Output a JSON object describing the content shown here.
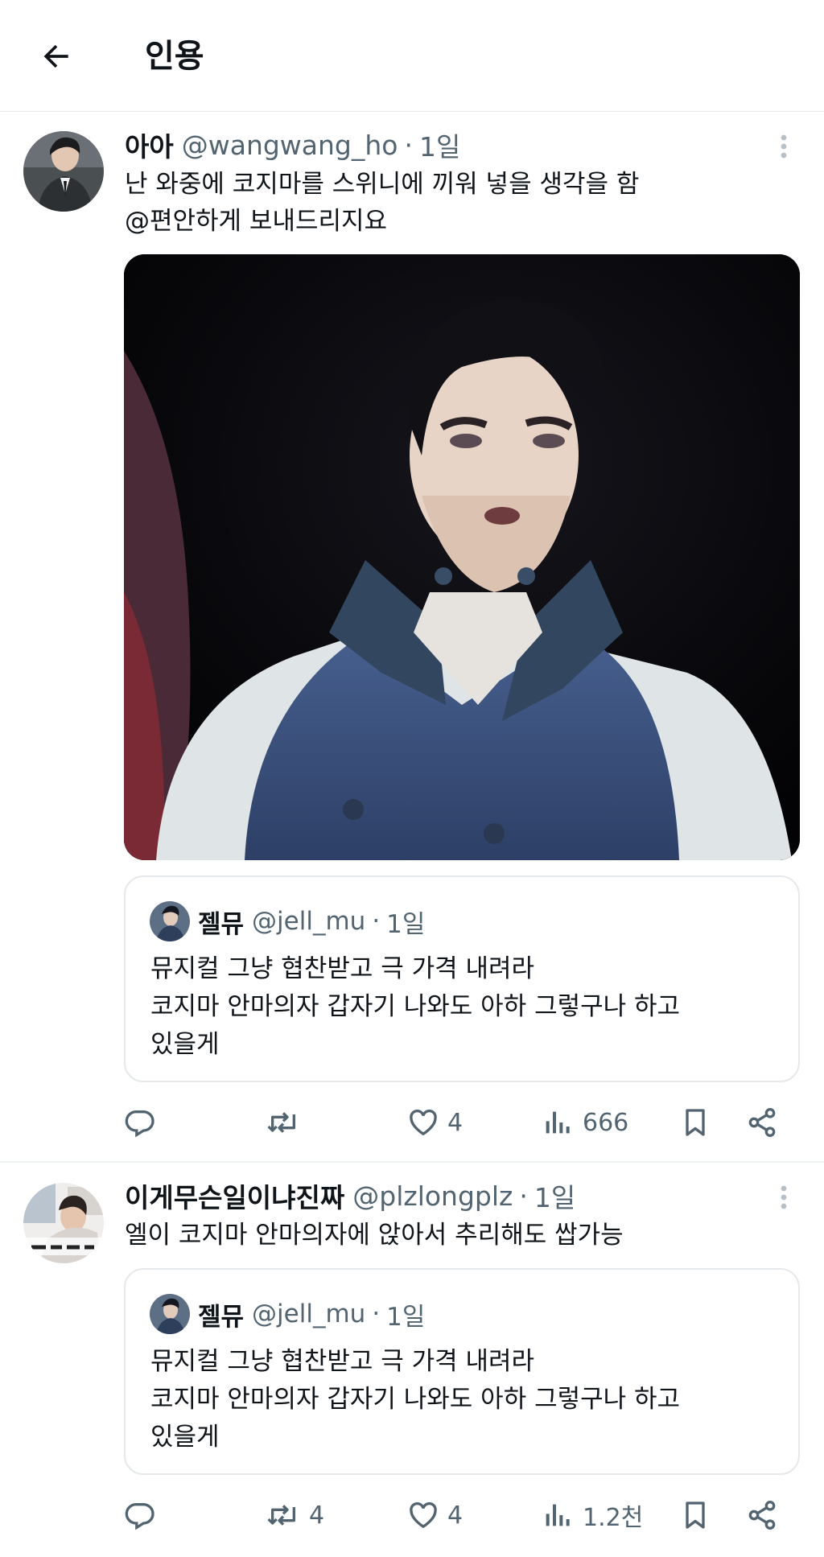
{
  "header": {
    "title": "인용",
    "back_icon": "arrow-left-icon"
  },
  "posts": [
    {
      "name": "아아",
      "handle": "@wangwang_ho",
      "dot": "·",
      "time": "1일",
      "text": "난 와중에 코지마를 스위니에 끼워 넣을 생각을 함\n@편안하게 보내드리지요",
      "quote": {
        "name": "젤뮤",
        "handle": "@jell_mu",
        "dot": "·",
        "time": "1일",
        "text": "뮤지컬 그냥 협찬받고 극 가격 내려라\n코지마 안마의자 갑자기 나와도 아하 그렇구나 하고\n있을게"
      },
      "actions": {
        "replies": "",
        "reposts": "",
        "likes": "4",
        "views": "666"
      }
    },
    {
      "name": "이게무슨일이냐진짜",
      "handle": "@plzlongplz",
      "dot": "·",
      "time": "1일",
      "text": "엘이 코지마 안마의자에 앉아서 추리해도 쌉가능",
      "quote": {
        "name": "젤뮤",
        "handle": "@jell_mu",
        "dot": "·",
        "time": "1일",
        "text": "뮤지컬 그냥 협찬받고 극 가격 내려라\n코지마 안마의자 갑자기 나와도 아하 그렇구나 하고\n있을게"
      },
      "actions": {
        "replies": "",
        "reposts": "4",
        "likes": "4",
        "views": "1.2천"
      }
    }
  ],
  "colors": {
    "text": "#0f1419",
    "secondary": "#536471",
    "border": "#e6e9eb"
  }
}
